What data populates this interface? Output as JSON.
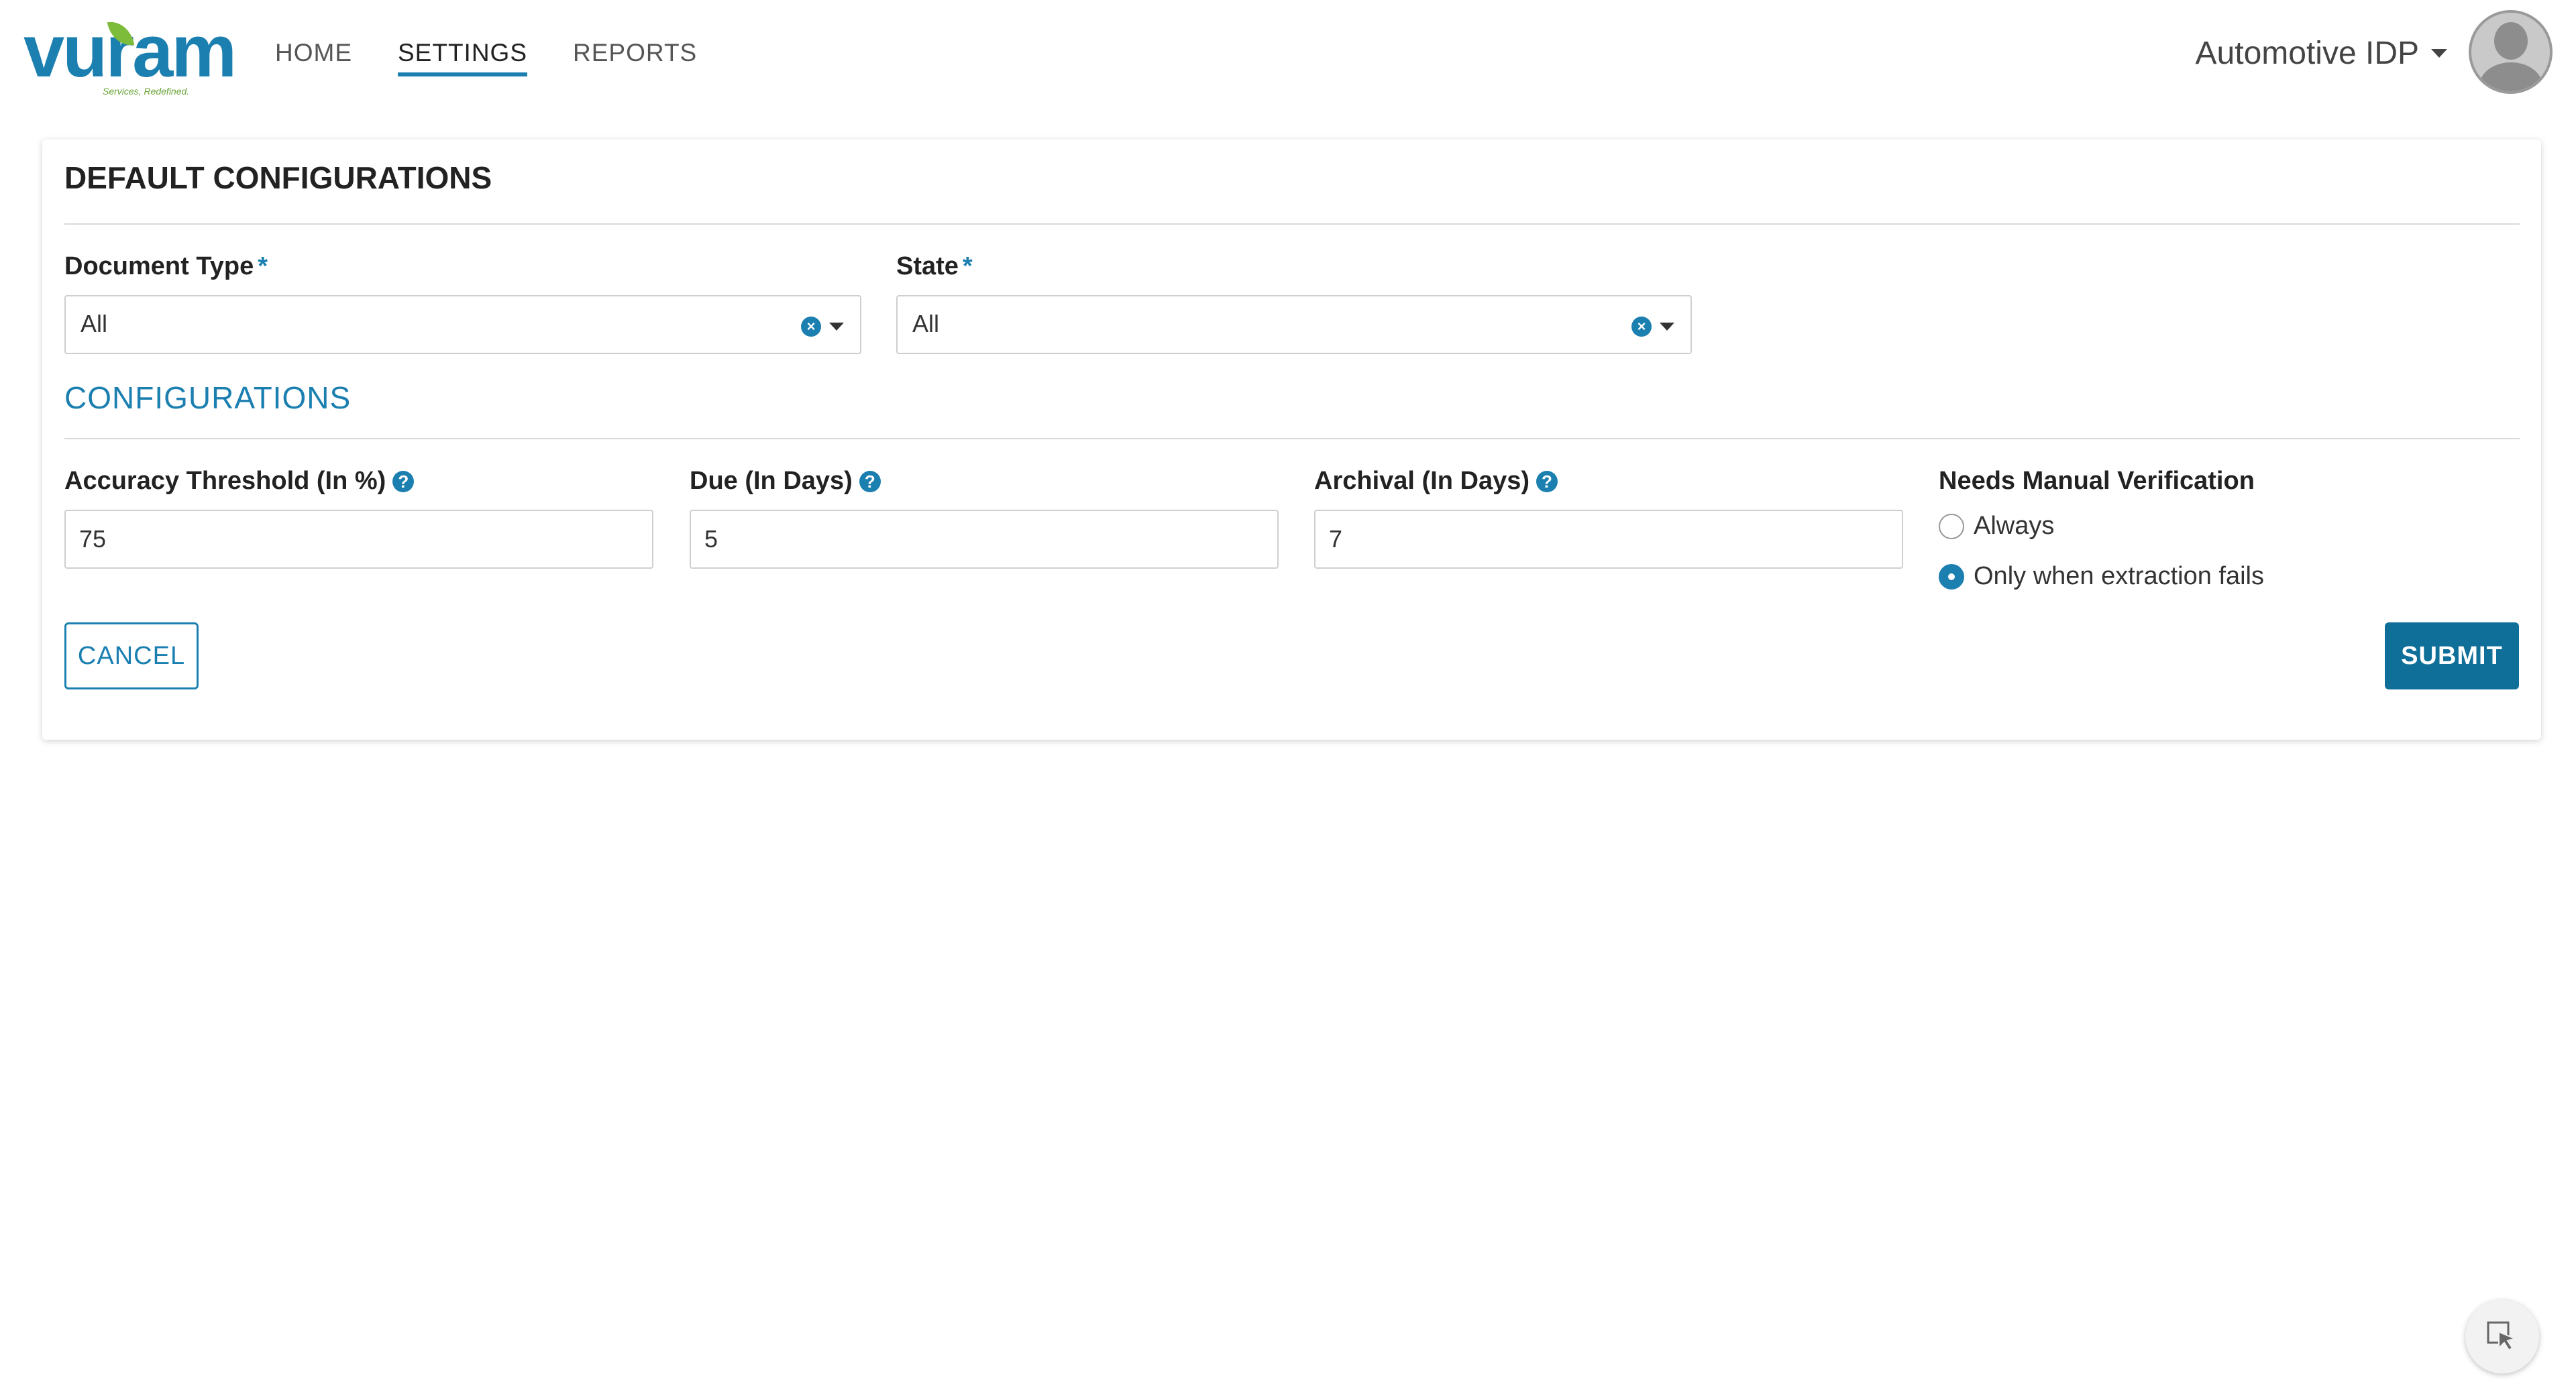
{
  "brand": {
    "logo_text": "vuram",
    "logo_tagline": "Services, Redefined.",
    "accent_color": "#1b7fb0",
    "leaf_color": "#7dbb3b"
  },
  "nav": {
    "items": [
      {
        "label": "HOME",
        "active": false
      },
      {
        "label": "SETTINGS",
        "active": true
      },
      {
        "label": "REPORTS",
        "active": false
      }
    ]
  },
  "account": {
    "tenant_label": "Automotive IDP",
    "avatar_icon": "user-avatar-icon"
  },
  "default_configurations": {
    "title": "DEFAULT CONFIGURATIONS",
    "document_type": {
      "label": "Document Type",
      "required_mark": "*",
      "value": "All"
    },
    "state": {
      "label": "State",
      "required_mark": "*",
      "value": "All"
    }
  },
  "configurations": {
    "title": "CONFIGURATIONS",
    "accuracy_threshold": {
      "label": "Accuracy Threshold (In %)",
      "value": "75"
    },
    "due": {
      "label": "Due (In Days)",
      "value": "5"
    },
    "archival": {
      "label": "Archival (In Days)",
      "value": "7"
    },
    "manual_verification": {
      "label": "Needs Manual Verification",
      "options": [
        {
          "label": "Always",
          "checked": false
        },
        {
          "label": "Only when extraction fails",
          "checked": true
        }
      ]
    }
  },
  "actions": {
    "cancel_label": "CANCEL",
    "submit_label": "SUBMIT"
  },
  "help_glyph": "?",
  "clear_glyph": "×"
}
